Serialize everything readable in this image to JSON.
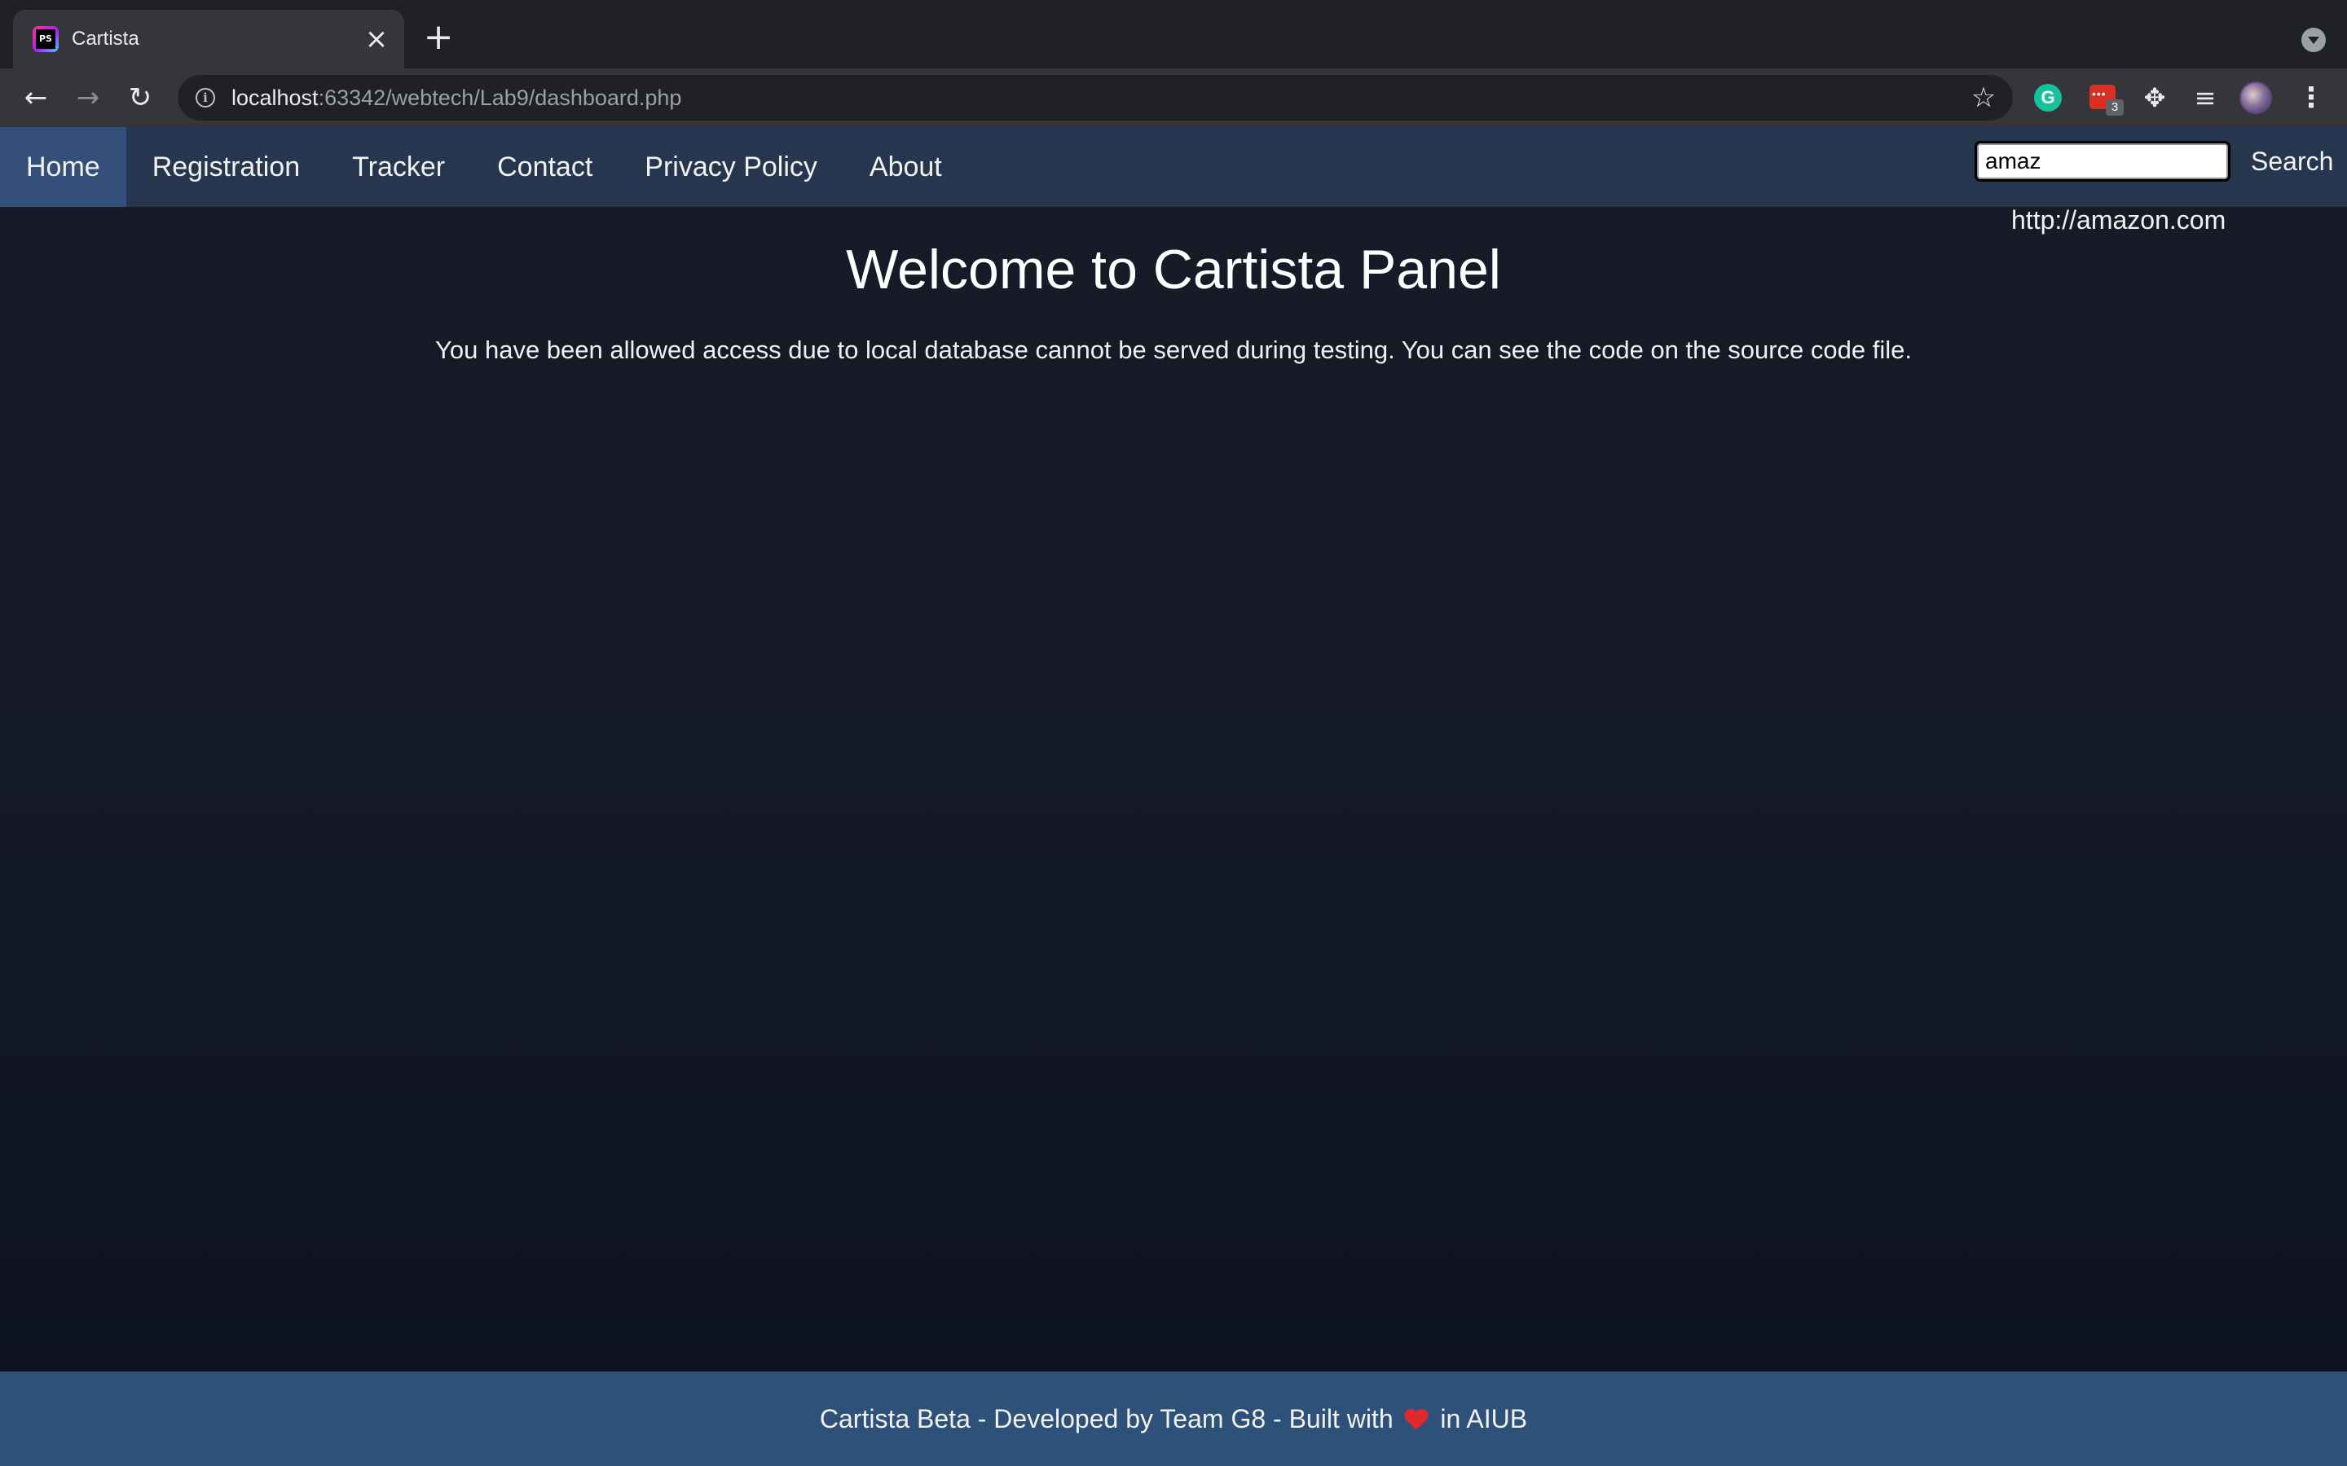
{
  "browser": {
    "tab_title": "Cartista",
    "url_host": "localhost",
    "url_rest": ":63342/webtech/Lab9/dashboard.php",
    "extension_badge": "3",
    "grammarly_letter": "G"
  },
  "nav": {
    "items": [
      {
        "label": "Home",
        "active": true
      },
      {
        "label": "Registration"
      },
      {
        "label": "Tracker"
      },
      {
        "label": "Contact"
      },
      {
        "label": "Privacy Policy"
      },
      {
        "label": "About"
      }
    ],
    "search_value": "amaz",
    "search_button": "Search",
    "suggestion": "http://amazon.com"
  },
  "main": {
    "title": "Welcome to Cartista Panel",
    "message": "You have been allowed access due to local database cannot be served during testing. You can see the code on the source code file."
  },
  "footer": {
    "text_before": "Cartista Beta - Developed by Team G8 - Built with",
    "text_after": "in AIUB"
  },
  "colors": {
    "navbar": "#26364e",
    "nav_active": "#34507a",
    "footer": "#2d5179",
    "page_bg": "#151a26",
    "heart": "#e0282d"
  }
}
